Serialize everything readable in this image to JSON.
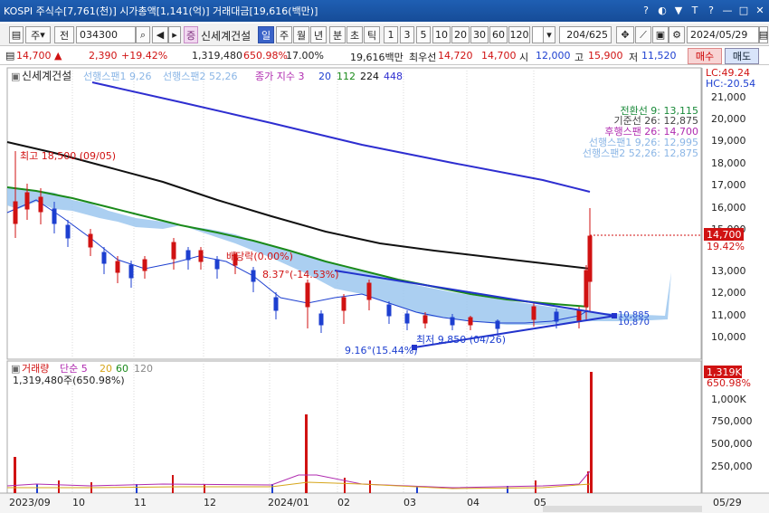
{
  "window": {
    "title": "KOSPI 주식수[7,761(천)] 시가총액[1,141(억)] 거래대금[19,616(백만)]",
    "controls": [
      "?",
      "◐",
      "▼",
      "T",
      "?",
      "—",
      "□",
      "✕"
    ]
  },
  "toolbar": {
    "sort_label": "주",
    "all_label": "전",
    "code": "034300",
    "stock_name": "신세계건설",
    "periods": [
      "일",
      "주",
      "월",
      "년",
      "분",
      "초",
      "틱"
    ],
    "selected_period": "일",
    "intervals": [
      "1",
      "3",
      "5",
      "10",
      "20",
      "30",
      "60",
      "120"
    ],
    "count": "204/625",
    "date": "2024/05/29"
  },
  "quote": {
    "price": "14,700",
    "arrow": "▲",
    "change": "2,390",
    "change_pct": "+19.42%",
    "volume": "1,319,480",
    "vol_pct": "650.98%",
    "turnover_pct": "17.00%",
    "amount": "19,616백만",
    "pref_label": "최우선",
    "ask": "14,720",
    "bid": "14,700",
    "open_label": "시",
    "open": "12,000",
    "high_label": "고",
    "high": "15,900",
    "low_label": "저",
    "low": "11,520",
    "buy_label": "매수",
    "sell_label": "매도"
  },
  "chart_labels": {
    "stock": "신세계건설",
    "span1_legend": "선행스팬1 9,26",
    "span2_legend": "선행스팬2 52,26",
    "ma_legend": "종가 지수 3",
    "ma_periods": [
      "20",
      "112",
      "224",
      "448"
    ],
    "lc": "LC:49.24",
    "hc": "HC:-20.54",
    "high_marker": "최고 18,500 (09/05)",
    "low_marker": "최저 9,850 (04/26)",
    "angle_upper": "8.37°(-14.53%)",
    "angle_lower": "9.16°(15.44%)",
    "rebound": "배당락(0.00%)",
    "trend_value": "10,885",
    "trend_value2": "10,870",
    "last_price": "14,700",
    "last_pct": "19.42%",
    "ichimoku": [
      {
        "label": "전환선 9: 13,115",
        "color": "#1a8a3a"
      },
      {
        "label": "기준선 26: 12,875",
        "color": "#444444"
      },
      {
        "label": "후행스팬 26: 14,700",
        "color": "#b02bb0"
      },
      {
        "label": "선행스팬1 9,26: 12,995",
        "color": "#8bb6e6"
      },
      {
        "label": "선행스팬2 52,26: 12,875",
        "color": "#8bb6e6"
      }
    ],
    "price_axis": [
      "21,000",
      "20,000",
      "19,000",
      "18,000",
      "17,000",
      "16,000",
      "15,000",
      "13,000",
      "12,000",
      "11,000",
      "10,000"
    ],
    "volume_title": "거래량",
    "volume_legend": [
      "단순 5",
      "20",
      "60",
      "120"
    ],
    "volume_readout": "1,319,480주(650.98%)",
    "volume_last": "1,319K",
    "volume_last_pct": "650.98%",
    "volume_axis": [
      "1,000K",
      "750,000",
      "500,000",
      "250,000"
    ],
    "date_axis": [
      "2023/09",
      "10",
      "11",
      "12",
      "2024/01",
      "02",
      "03",
      "04",
      "05",
      "05/29"
    ]
  },
  "colors": {
    "up": "#d01212",
    "down": "#1d3fd0",
    "cloud": "#9cc7ef",
    "ma20": "#1d3fd0",
    "ma112": "#1a8a1a",
    "ma224": "#111111",
    "ma448": "#2e2ed0"
  }
}
